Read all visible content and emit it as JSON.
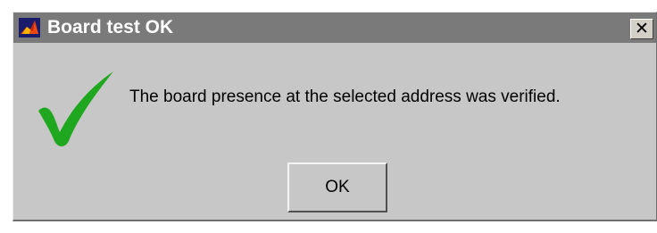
{
  "window": {
    "title": "Board test OK",
    "close_label": "✕"
  },
  "message": {
    "text": "The board presence at the selected address was verified."
  },
  "buttons": {
    "ok_label": "OK"
  },
  "colors": {
    "check": "#1fa71f",
    "titlebar": "#7a7a7a",
    "dialog_bg": "#c7c7c7"
  },
  "icons": {
    "app": "matlab-logo-icon",
    "status": "checkmark-icon",
    "close": "close-icon"
  }
}
